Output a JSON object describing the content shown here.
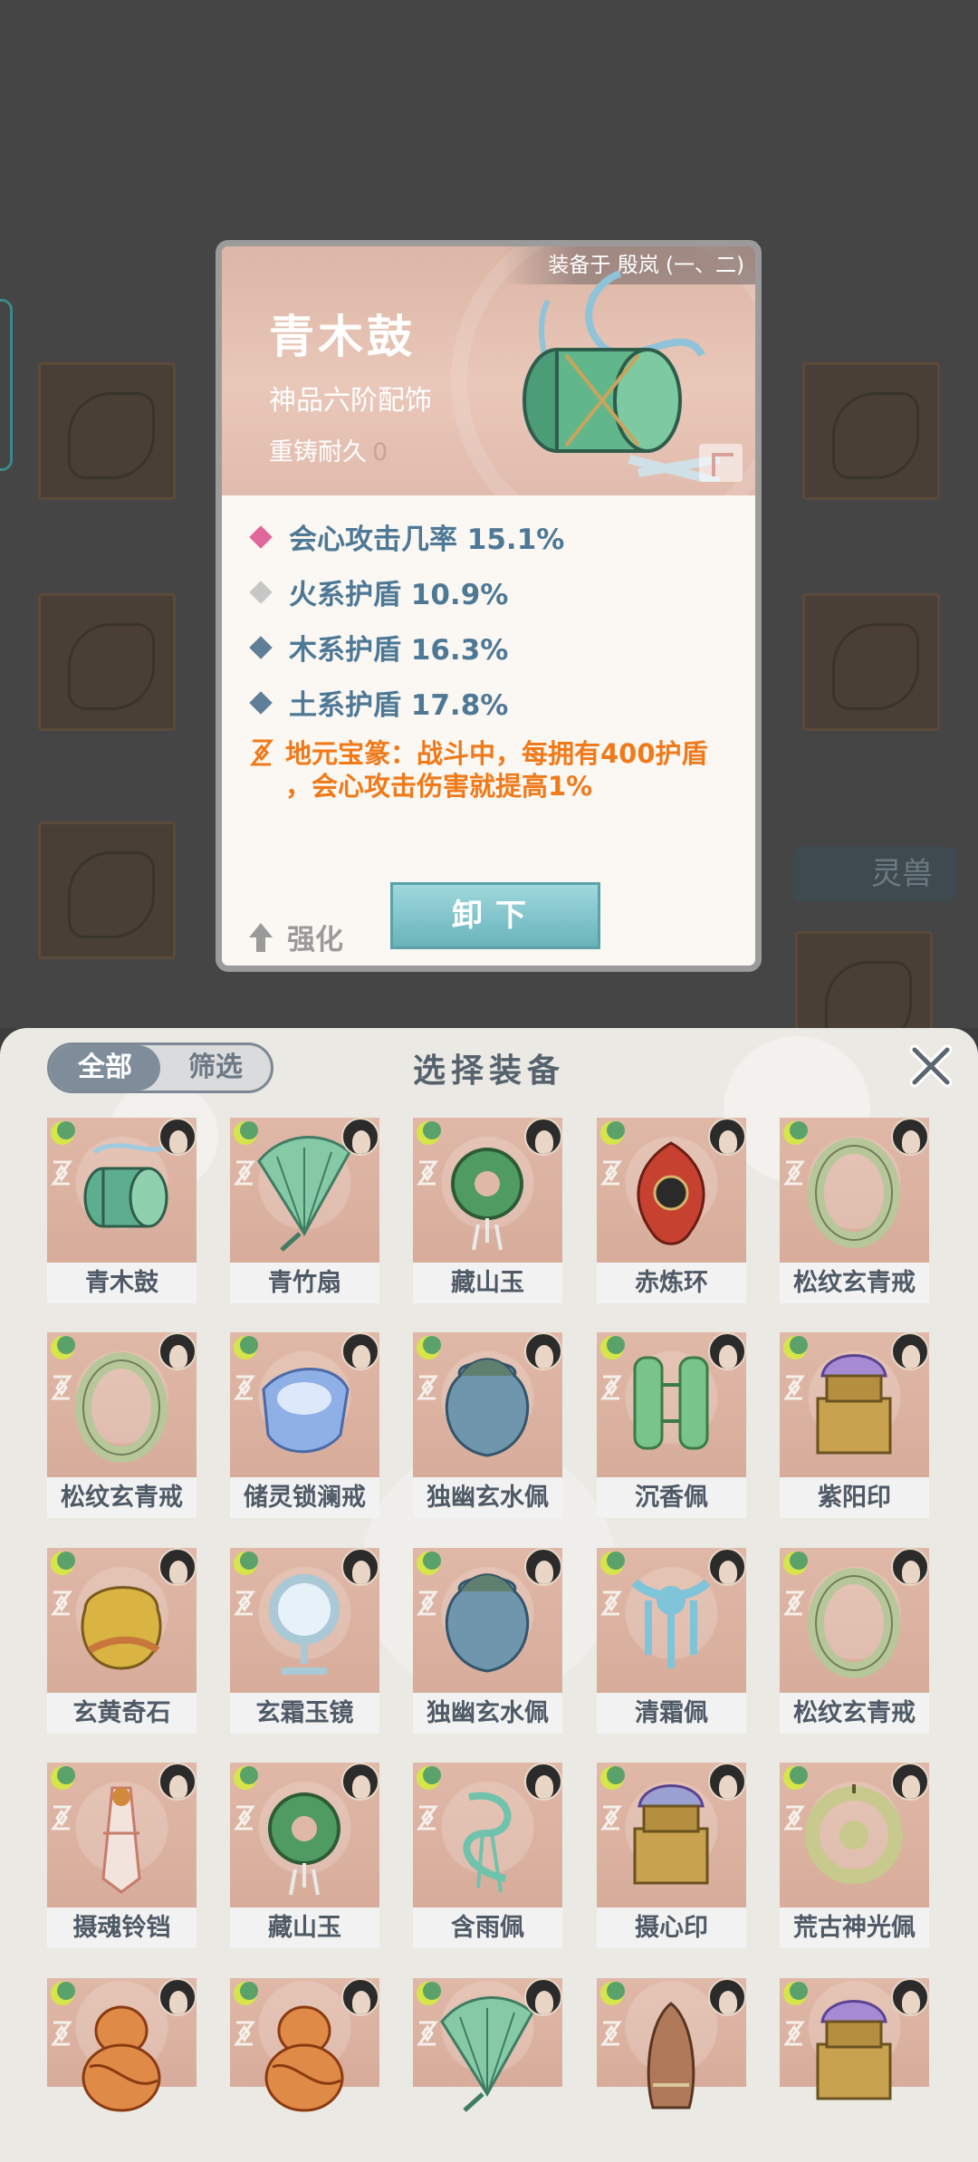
{
  "background": {
    "tag_label": "灵兽"
  },
  "detail_card": {
    "equipped_to": "装备于 殷岚 (一、二)",
    "name": "青木鼓",
    "rank": "神品六阶配饰",
    "durability_label": "重铸耐久",
    "durability_value": "0",
    "stats": [
      {
        "text": "会心攻击几率 15.1%",
        "color": "#e0679b"
      },
      {
        "text": "火系护盾 10.9%",
        "color": "#c7c7c7"
      },
      {
        "text": "木系护盾 16.3%",
        "color": "#5f7e97"
      },
      {
        "text": "土系护盾 17.8%",
        "color": "#5f7e97"
      }
    ],
    "skill_text_line1": "地元宝篆：战斗中，每拥有400护盾",
    "skill_text_line2": "，会心攻击伤害就提高1%",
    "upgrade_label": "强化",
    "unequip_label": "卸下"
  },
  "panel": {
    "tab_all": "全部",
    "tab_filter": "筛选",
    "title": "选择装备",
    "items": [
      {
        "name": "青木鼓",
        "art": "drum",
        "color": "#5cae8e"
      },
      {
        "name": "青竹扇",
        "art": "fan",
        "color": "#86c9a6"
      },
      {
        "name": "藏山玉",
        "art": "ring",
        "color": "#4f9b61"
      },
      {
        "name": "赤炼环",
        "art": "flame",
        "color": "#c6412f"
      },
      {
        "name": "松纹玄青戒",
        "art": "bangle",
        "color": "#b7c79a"
      },
      {
        "name": "松纹玄青戒",
        "art": "bangle",
        "color": "#b7c79a"
      },
      {
        "name": "储灵锁澜戒",
        "art": "cuff",
        "color": "#8fb0e6"
      },
      {
        "name": "独幽玄水佩",
        "art": "jar",
        "color": "#6f96ad"
      },
      {
        "name": "沉香佩",
        "art": "chain",
        "color": "#79c489"
      },
      {
        "name": "紫阳印",
        "art": "seal",
        "color": "#a68bd4"
      },
      {
        "name": "玄黄奇石",
        "art": "rock",
        "color": "#d9b442"
      },
      {
        "name": "玄霜玉镜",
        "art": "mirror",
        "color": "#a9c9d6"
      },
      {
        "name": "独幽玄水佩",
        "art": "jar",
        "color": "#6f96ad"
      },
      {
        "name": "清霜佩",
        "art": "pendant",
        "color": "#7fc4d8"
      },
      {
        "name": "松纹玄青戒",
        "art": "bangle",
        "color": "#b7c79a"
      },
      {
        "name": "摄魂铃铛",
        "art": "bell",
        "color": "#e9a89a"
      },
      {
        "name": "藏山玉",
        "art": "ring",
        "color": "#4f9b61"
      },
      {
        "name": "含雨佩",
        "art": "knot",
        "color": "#6fc2ab"
      },
      {
        "name": "摄心印",
        "art": "seal",
        "color": "#9aa0cf"
      },
      {
        "name": "荒古神光佩",
        "art": "disc",
        "color": "#c8c98c"
      },
      {
        "name": "",
        "art": "gourd",
        "color": "#e08a48"
      },
      {
        "name": "",
        "art": "gourd",
        "color": "#e08a48"
      },
      {
        "name": "",
        "art": "fan",
        "color": "#86c9a6"
      },
      {
        "name": "",
        "art": "horn",
        "color": "#b07a5a"
      },
      {
        "name": "",
        "art": "seal",
        "color": "#a68bd4"
      }
    ]
  }
}
